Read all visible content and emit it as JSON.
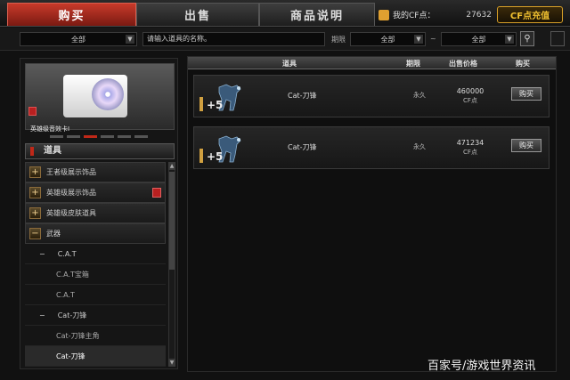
{
  "tabs": [
    {
      "label": "购买",
      "active": true
    },
    {
      "label": "出售",
      "active": false
    },
    {
      "label": "商品说明",
      "active": false
    }
  ],
  "cf": {
    "label": "我的CF点：",
    "value": "27632",
    "recharge": "CF点充值"
  },
  "filters": {
    "category": "全部",
    "search_placeholder": "请输入道具的名称。",
    "period_label": "期限",
    "period_from": "全部",
    "range_sep": "~",
    "period_to": "全部"
  },
  "preview": {
    "name": "英雄级音效卡I"
  },
  "sidebar": {
    "header": "道具",
    "nodes": [
      {
        "label": "王者级展示饰品",
        "type": "cat",
        "toggle": "+"
      },
      {
        "label": "英雄级展示饰品",
        "type": "cat",
        "toggle": "+",
        "badge": true
      },
      {
        "label": "英雄级皮肤道具",
        "type": "cat",
        "toggle": "+"
      },
      {
        "label": "武器",
        "type": "cat",
        "toggle": "−"
      },
      {
        "label": "C.A.T",
        "type": "sub",
        "toggle": "−"
      },
      {
        "label": "C.A.T宝箱",
        "type": "sub2"
      },
      {
        "label": "C.A.T",
        "type": "sub2"
      },
      {
        "label": "Cat-刀锋",
        "type": "sub",
        "toggle": "−"
      },
      {
        "label": "Cat-刀锋主角",
        "type": "sub2"
      },
      {
        "label": "Cat-刀锋",
        "type": "sub2",
        "selected": true
      }
    ]
  },
  "table": {
    "columns": [
      "道具",
      "期限",
      "出售价格",
      "购买"
    ],
    "rows": [
      {
        "plus": "+5",
        "name": "Cat-刀锋",
        "duration": "永久",
        "price": "460000",
        "unit": "CF点",
        "buy": "购买"
      },
      {
        "plus": "+5",
        "name": "Cat-刀锋",
        "duration": "永久",
        "price": "471234",
        "unit": "CF点",
        "buy": "购买"
      }
    ]
  },
  "watermark": "百家号/游戏世界资讯"
}
